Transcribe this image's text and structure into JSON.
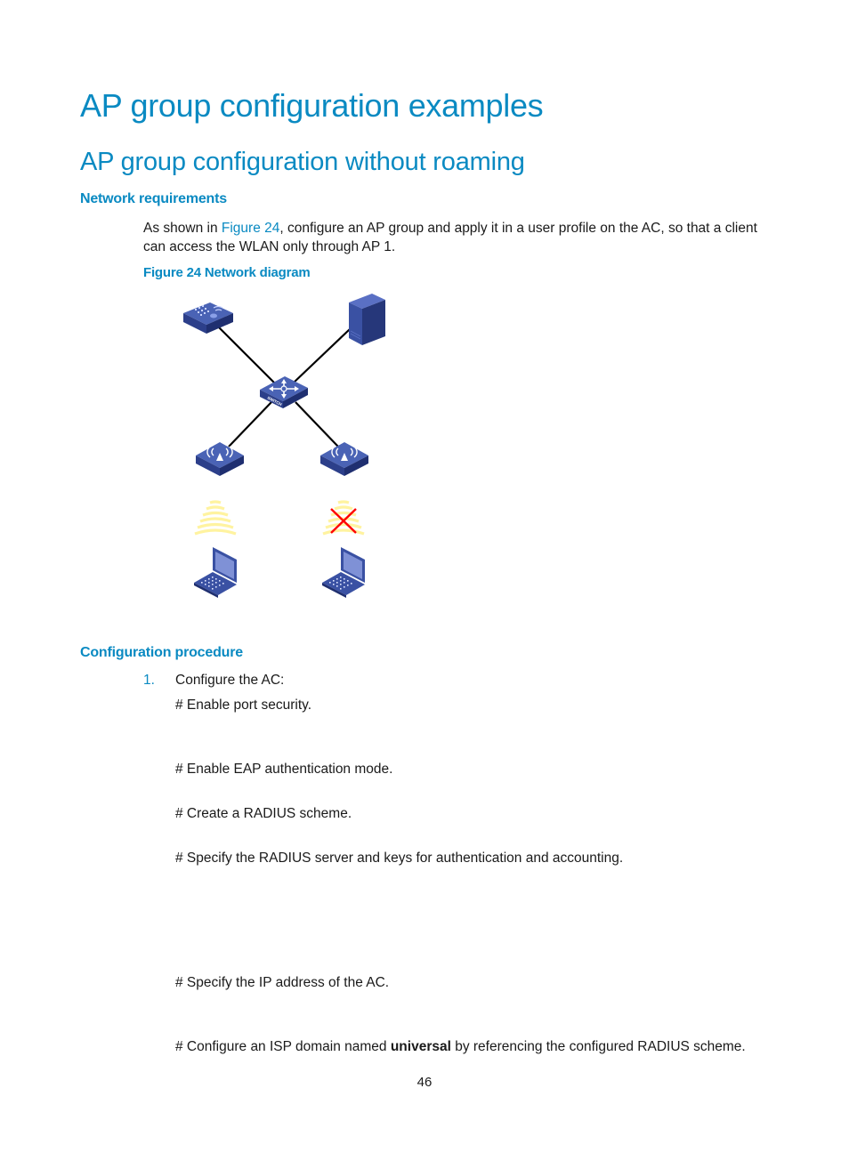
{
  "document": {
    "title": "AP group configuration examples",
    "section_title": "AP group configuration without roaming",
    "network_requirements": {
      "heading": "Network requirements",
      "paragraph_prefix": "As shown in ",
      "figure_link": "Figure 24",
      "paragraph_suffix": ", configure an AP group and apply it in a user profile on the AC, so that a client can access the WLAN only through AP 1.",
      "figure_caption": "Figure 24 Network diagram"
    },
    "diagram": {
      "switch_label": "SWITCH",
      "colors": {
        "device_blue": "#3a51a3",
        "device_dark": "#26377a",
        "link_black": "#000000",
        "signal_yellow": "#fff3a0",
        "blocked_red": "#ff0000"
      },
      "nodes": [
        "ac-device",
        "radius-server",
        "switch",
        "ap-1",
        "ap-2",
        "client-1",
        "client-2"
      ],
      "blocked_signal": "ap-2"
    },
    "configuration_procedure": {
      "heading": "Configuration procedure",
      "steps": [
        {
          "number": "1.",
          "label": "Configure the AC:",
          "comments": [
            "# Enable port security.",
            "# Enable EAP authentication mode.",
            "# Create a RADIUS scheme.",
            "# Specify the RADIUS server and keys for authentication and accounting.",
            "# Specify the IP address of the AC."
          ],
          "last_comment": {
            "prefix": "# Configure an ISP domain named ",
            "bold": "universal",
            "suffix": " by referencing the configured RADIUS scheme."
          }
        }
      ]
    },
    "page_number": "46"
  }
}
